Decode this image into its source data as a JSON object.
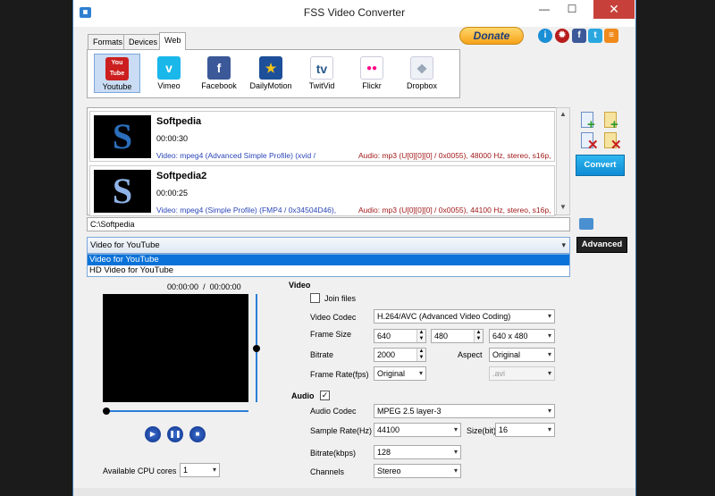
{
  "window": {
    "title": "FSS Video Converter",
    "app_icon": "app-icon",
    "min": "—",
    "max": "☐",
    "close": "✕"
  },
  "tabs": [
    {
      "label": "Formats"
    },
    {
      "label": "Devices"
    },
    {
      "label": "Web",
      "active": true
    }
  ],
  "sites": [
    {
      "label": "Youtube",
      "glyph": "You Tube",
      "color": "#cc1f1f",
      "selected": true
    },
    {
      "label": "Vimeo",
      "glyph": "v",
      "color": "#1ab7ea"
    },
    {
      "label": "Facebook",
      "glyph": "f",
      "color": "#3b5998"
    },
    {
      "label": "DailyMotion",
      "glyph": "★",
      "color": "#1d4f9a"
    },
    {
      "label": "TwitVid",
      "glyph": "tv",
      "color": "#7aa4c8"
    },
    {
      "label": "Flickr",
      "glyph": "●●",
      "color": "#ffffff"
    },
    {
      "label": "Dropbox",
      "glyph": "❖",
      "color": "#9aa6b8"
    }
  ],
  "donate_label": "Donate",
  "top_icons": [
    {
      "name": "info-icon",
      "glyph": "i",
      "color": "#1a8fd6"
    },
    {
      "name": "bug-icon",
      "glyph": "✹",
      "color": "#b81c1c"
    },
    {
      "name": "facebook-icon",
      "glyph": "f",
      "color": "#3b5998"
    },
    {
      "name": "twitter-icon",
      "glyph": "t",
      "color": "#2aa7df"
    },
    {
      "name": "rss-icon",
      "glyph": "≡",
      "color": "#f08a1c"
    }
  ],
  "files": [
    {
      "name": "Softpedia",
      "duration": "00:00:30",
      "thumb": "S",
      "video": "Video: mpeg4 (Advanced Simple Profile) (xvid /",
      "audio": "Audio: mp3 (U[0][0][0] / 0x0055), 48000 Hz, stereo, s16p,"
    },
    {
      "name": "Softpedia2",
      "duration": "00:00:25",
      "thumb": "S",
      "video": "Video: mpeg4 (Simple Profile) (FMP4 / 0x34504D46),",
      "audio": "Audio: mp3 (U[0][0][0] / 0x0055), 44100 Hz, stereo, s16p,"
    }
  ],
  "convert_label": "Convert",
  "output_path": "C:\\Softpedia",
  "profile": {
    "selected": "Video for YouTube",
    "options": [
      "Video for YouTube",
      "HD Video for YouTube"
    ]
  },
  "advanced_label": "Advanced",
  "player": {
    "current": "00:00:00",
    "sep": "/",
    "total": "00:00:00"
  },
  "cpu": {
    "label": "Available CPU cores",
    "value": "1"
  },
  "video": {
    "section": "Video",
    "join_files": "Join files",
    "codec_label": "Video Codec",
    "codec": "H.264/AVC (Advanced Video Coding)",
    "frame_size_label": "Frame Size",
    "width": "640",
    "height": "480",
    "size_preset": "640 x 480",
    "bitrate_label": "Bitrate",
    "bitrate": "2000",
    "aspect_label": "Aspect",
    "aspect": "Original",
    "framerate_label": "Frame Rate(fps)",
    "framerate": "Original",
    "container": ".avi"
  },
  "audio": {
    "section": "Audio",
    "enabled": "✓",
    "codec_label": "Audio Codec",
    "codec": "MPEG 2.5 layer-3",
    "samplerate_label": "Sample Rate(Hz)",
    "samplerate": "44100",
    "size_label": "Size(bit)",
    "size": "16",
    "bitrate_label": "Bitrate(kbps)",
    "bitrate": "128",
    "channels_label": "Channels",
    "channels": "Stereo"
  }
}
